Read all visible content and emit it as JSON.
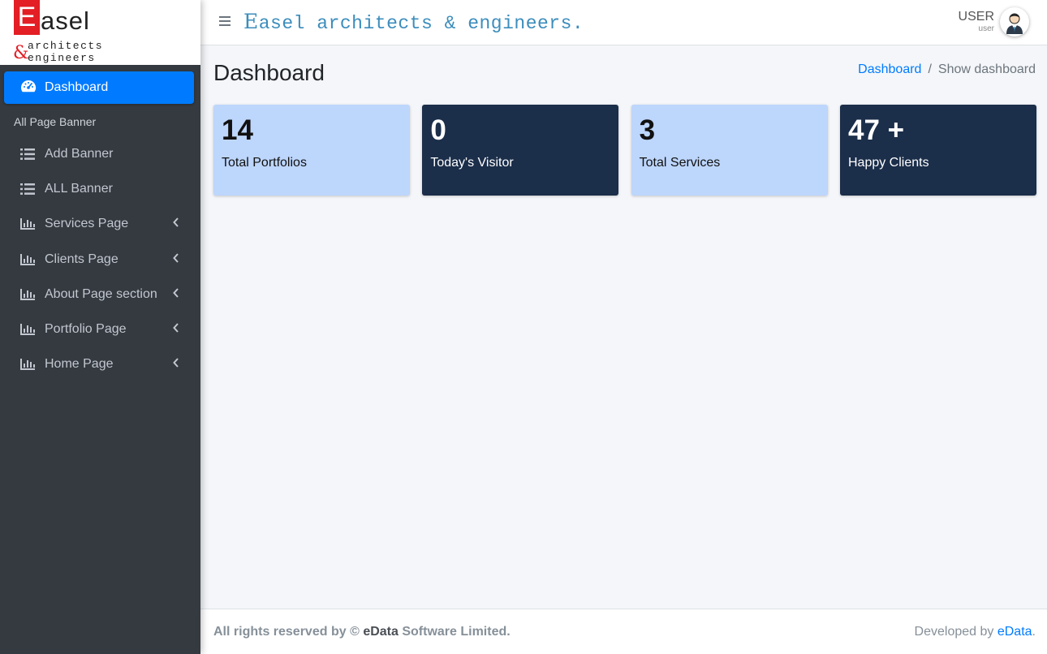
{
  "brand": {
    "logo_initial": "E",
    "logo_rest": "asel",
    "logo_ampersand": "&",
    "logo_line1": "architects",
    "logo_line2": "engineers"
  },
  "sidebar": {
    "active_item": {
      "label": "Dashboard",
      "icon": "tachometer-icon"
    },
    "section_header": "All Page Banner",
    "items": [
      {
        "label": "Add Banner",
        "icon": "list-icon",
        "has_submenu": false
      },
      {
        "label": "ALL Banner",
        "icon": "list-icon",
        "has_submenu": false
      },
      {
        "label": "Services Page",
        "icon": "bar-chart-icon",
        "has_submenu": true
      },
      {
        "label": "Clients Page",
        "icon": "bar-chart-icon",
        "has_submenu": true
      },
      {
        "label": "About Page section",
        "icon": "bar-chart-icon",
        "has_submenu": true
      },
      {
        "label": "Portfolio Page",
        "icon": "bar-chart-icon",
        "has_submenu": true
      },
      {
        "label": "Home Page",
        "icon": "bar-chart-icon",
        "has_submenu": true
      }
    ]
  },
  "topbar": {
    "title_initial": "E",
    "title_rest": "asel architects & engineers.",
    "user_name": "USER",
    "user_role": "user"
  },
  "main": {
    "page_title": "Dashboard",
    "breadcrumb": {
      "link": "Dashboard",
      "separator": "/",
      "current": "Show dashboard"
    },
    "cards": [
      {
        "value": "14",
        "label": "Total Portfolios",
        "theme": "light"
      },
      {
        "value": "0",
        "label": "Today's Visitor",
        "theme": "dark"
      },
      {
        "value": "3",
        "label": "Total Services",
        "theme": "light"
      },
      {
        "value": "47 +",
        "label": "Happy Clients",
        "theme": "dark"
      }
    ]
  },
  "footer": {
    "left_prefix": "All rights reserved by ©",
    "left_brand": "eData",
    "left_suffix": "Software Limited.",
    "right_prefix": "Developed by",
    "right_link": "eData",
    "right_suffix": "."
  },
  "colors": {
    "accent": "#007bff",
    "sidebar_bg": "#343a40",
    "card_light": "#bdd6fc",
    "card_dark": "#1b2e4a",
    "logo_red": "#e31e24",
    "title_blue": "#3c8dbc"
  }
}
